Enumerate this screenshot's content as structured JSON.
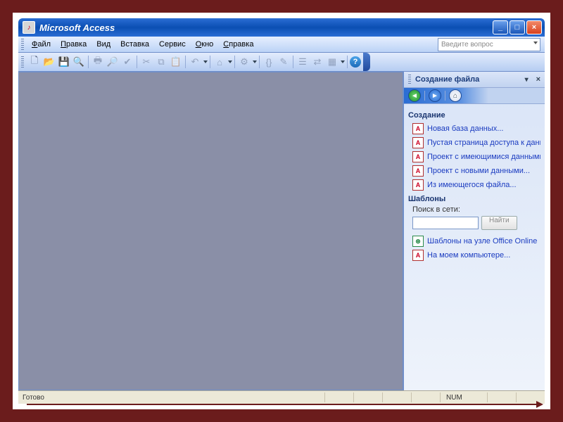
{
  "title": "Microsoft Access",
  "menubar": {
    "file": "Файл",
    "edit": "Правка",
    "view": "Вид",
    "insert": "Вставка",
    "tools": "Сервис",
    "window": "Окно",
    "help": "Справка"
  },
  "question_box_placeholder": "Введите вопрос",
  "taskpane": {
    "title": "Создание файла",
    "section_create": "Создание",
    "links": {
      "new_db": "Новая база данных...",
      "blank_page": "Пустая страница доступа к данным",
      "proj_existing": "Проект с имеющимися данными...",
      "proj_new": "Проект с новыми данными...",
      "from_file": "Из имеющегося файла..."
    },
    "section_templates": "Шаблоны",
    "search_label": "Поиск в сети:",
    "search_button": "Найти",
    "tpl_online": "Шаблоны на узле Office Online",
    "tpl_local": "На моем компьютере..."
  },
  "statusbar": {
    "ready": "Готово",
    "num": "NUM"
  }
}
